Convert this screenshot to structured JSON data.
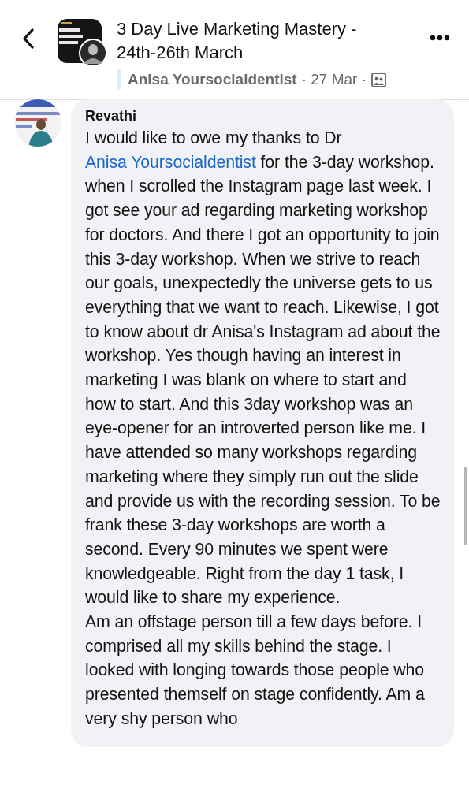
{
  "header": {
    "title": "3 Day Live Marketing Mastery - 24th-26th March",
    "author": "Anisa Yoursocialdentist",
    "date": "· 27 Mar ·"
  },
  "comment": {
    "name": "Revathi",
    "before": "I would like to owe my thanks to Dr ",
    "mention": "Anisa Yoursocialdentist",
    "after": " for the 3-day workshop. when I scrolled the Instagram page last week. I got see your ad regarding marketing workshop for doctors. And there I got an opportunity to join this 3-day workshop. When we strive to reach our goals, unexpectedly the universe gets to us everything that we want to reach. Likewise, I got to know about dr Anisa's Instagram ad about the workshop. Yes though having an interest in marketing I was blank on where to start and how to start. And this 3day workshop was an eye-opener for an introverted person like me. I have attended so many workshops regarding marketing where they simply run out the slide and provide us with the recording session. To be frank these 3-day workshops are worth a second. Every 90 minutes we spent were knowledgeable. Right from the day 1 task, I would like to share my experience.",
    "paragraph_2": "Am an offstage person till a few days before. I comprised all my skills behind the stage. I looked with longing towards those people who presented themself on stage confidently. Am a very shy person who"
  }
}
